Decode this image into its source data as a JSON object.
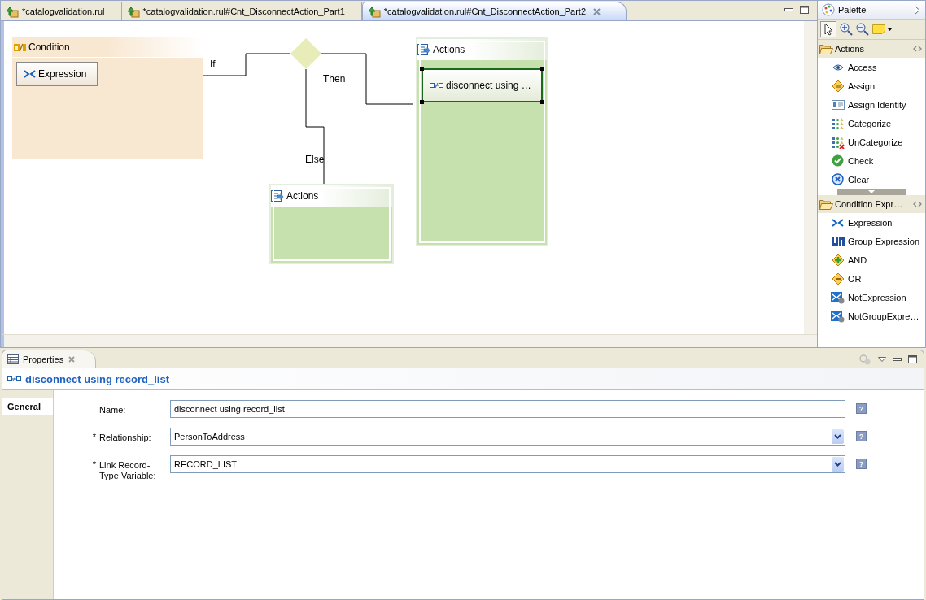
{
  "tabs": [
    {
      "label": "*catalogvalidation.rul",
      "selected": false
    },
    {
      "label": "*catalogvalidation.rul#Cnt_DisconnectAction_Part1",
      "selected": false
    },
    {
      "label": "*catalogvalidation.rul#Cnt_DisconnectAction_Part2",
      "selected": true
    }
  ],
  "diagram": {
    "condition": {
      "title": "Condition",
      "items": [
        {
          "label": "Expression"
        }
      ]
    },
    "connectors": [
      {
        "label": "If"
      },
      {
        "label": "Then"
      },
      {
        "label": "Else"
      }
    ],
    "then_actions": {
      "title": "Actions",
      "items": [
        {
          "label": "disconnect using …",
          "selected": true
        }
      ]
    },
    "else_actions": {
      "title": "Actions"
    }
  },
  "palette": {
    "title": "Palette",
    "drawers": [
      {
        "title": "Actions",
        "expanded": true,
        "items": [
          {
            "label": "Access"
          },
          {
            "label": "Assign"
          },
          {
            "label": "Assign Identity"
          },
          {
            "label": "Categorize"
          },
          {
            "label": "UnCategorize"
          },
          {
            "label": "Check"
          },
          {
            "label": "Clear"
          }
        ]
      },
      {
        "title": "Condition Expr…",
        "expanded": true,
        "items": [
          {
            "label": "Expression"
          },
          {
            "label": "Group Expression"
          },
          {
            "label": "AND"
          },
          {
            "label": "OR"
          },
          {
            "label": "NotExpression"
          },
          {
            "label": "NotGroupExpre…"
          }
        ]
      }
    ]
  },
  "properties": {
    "title": "Properties",
    "header": "disconnect using record_list",
    "tabs": [
      {
        "label": "General",
        "selected": true
      }
    ],
    "fields": [
      {
        "label": "Name:",
        "kind": "text",
        "value": "disconnect using record_list",
        "help": "?"
      },
      {
        "mark": "*",
        "label": "Relationship:",
        "kind": "combo",
        "value": "PersonToAddress",
        "help": "?"
      },
      {
        "mark": "*",
        "label": "Link Record-Type Variable:",
        "kind": "combo",
        "value": "RECORD_LIST",
        "help": "?"
      }
    ]
  }
}
